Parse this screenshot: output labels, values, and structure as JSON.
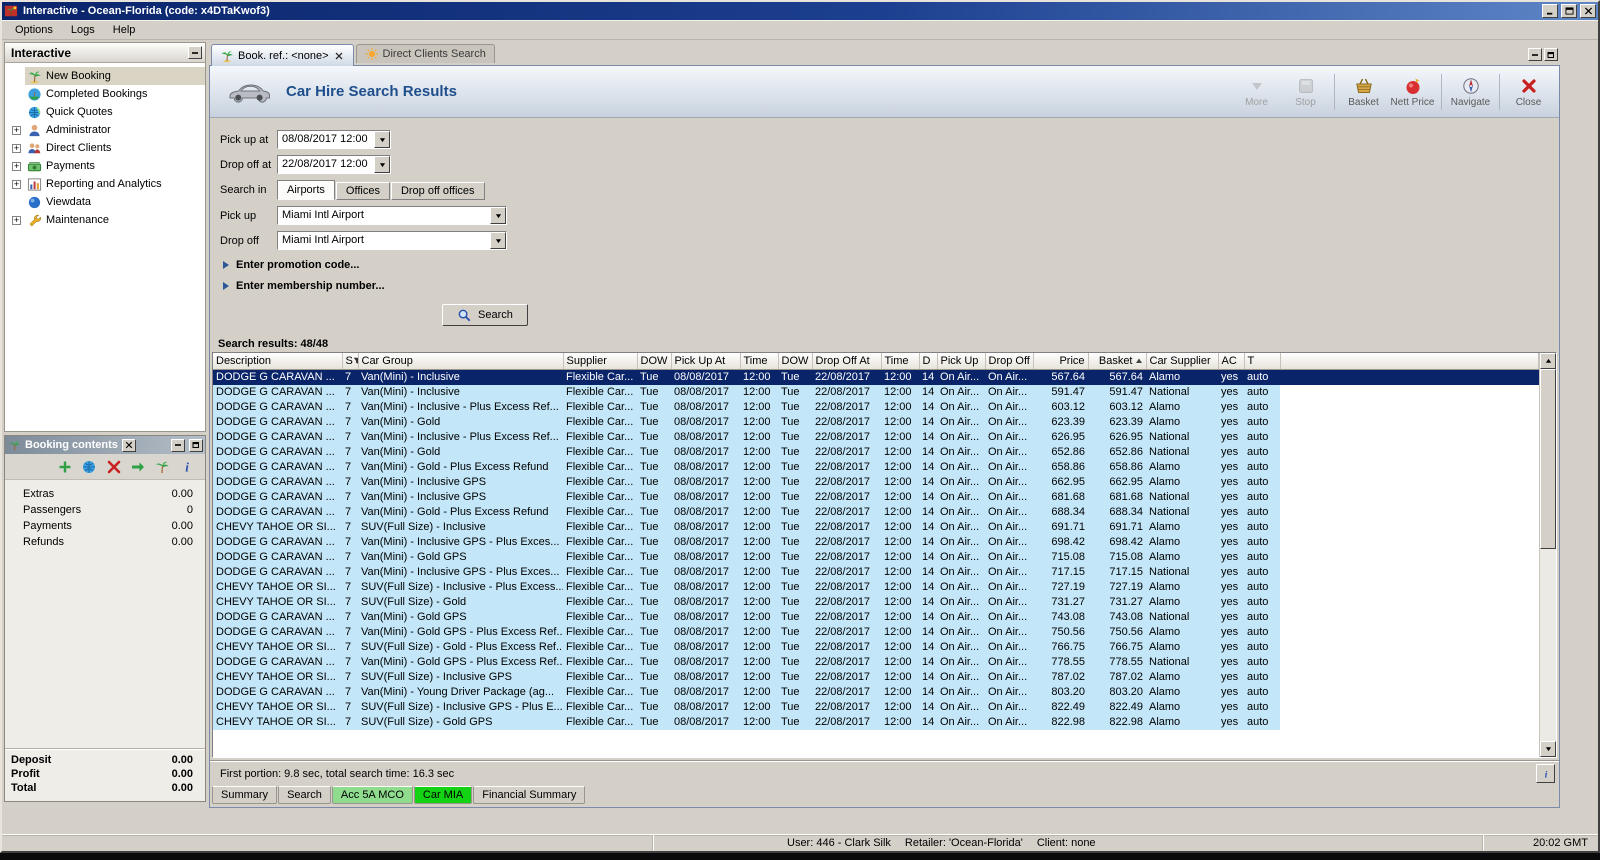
{
  "titlebar": {
    "title": "Interactive - Ocean-Florida (code: x4DTaKwof3)"
  },
  "menubar": {
    "items": [
      "Options",
      "Logs",
      "Help"
    ]
  },
  "sidebar": {
    "title": "Interactive",
    "items": [
      {
        "label": "New Booking",
        "icon": "palm-icon",
        "expandable": false,
        "selected": true
      },
      {
        "label": "Completed Bookings",
        "icon": "completed-bookings-icon",
        "expandable": false,
        "selected": false
      },
      {
        "label": "Quick Quotes",
        "icon": "quick-quotes-icon",
        "expandable": false,
        "selected": false
      },
      {
        "label": "Administrator",
        "icon": "administrator-icon",
        "expandable": true,
        "selected": false
      },
      {
        "label": "Direct Clients",
        "icon": "direct-clients-icon",
        "expandable": true,
        "selected": false
      },
      {
        "label": "Payments",
        "icon": "payments-icon",
        "expandable": true,
        "selected": false
      },
      {
        "label": "Reporting and Analytics",
        "icon": "reporting-icon",
        "expandable": true,
        "selected": false
      },
      {
        "label": "Viewdata",
        "icon": "viewdata-icon",
        "expandable": false,
        "selected": false
      },
      {
        "label": "Maintenance",
        "icon": "maintenance-icon",
        "expandable": true,
        "selected": false
      }
    ]
  },
  "booking_contents": {
    "title": "Booking contents",
    "toolbar": [
      {
        "icon": "add-icon"
      },
      {
        "icon": "globe-icon"
      },
      {
        "icon": "delete-icon"
      },
      {
        "icon": "transfer-icon"
      },
      {
        "icon": "palm-small-icon"
      },
      {
        "icon": "info-icon"
      }
    ],
    "rows": [
      {
        "label": "Extras",
        "value": "0.00"
      },
      {
        "label": "Passengers",
        "value": "0"
      },
      {
        "label": "Payments",
        "value": "0.00"
      },
      {
        "label": "Refunds",
        "value": "0.00"
      }
    ],
    "totals": [
      {
        "label": "Deposit",
        "value": "0.00"
      },
      {
        "label": "Profit",
        "value": "0.00"
      },
      {
        "label": "Total",
        "value": "0.00"
      }
    ]
  },
  "document_tabs": [
    {
      "label": "Book. ref.: <none>",
      "icon": "palm-icon",
      "closable": true,
      "active": true
    },
    {
      "label": "Direct Clients Search",
      "icon": "sun-icon",
      "closable": false,
      "active": false
    }
  ],
  "page": {
    "title": "Car Hire Search Results"
  },
  "action_toolbar": [
    {
      "label": "More",
      "icon": "more-icon",
      "disabled": true
    },
    {
      "label": "Stop",
      "icon": "stop-icon",
      "disabled": true
    },
    {
      "label": "Basket",
      "icon": "basket-icon",
      "disabled": false
    },
    {
      "label": "Nett Price",
      "icon": "nett-price-icon",
      "disabled": false
    },
    {
      "label": "Navigate",
      "icon": "navigate-icon",
      "disabled": false
    },
    {
      "label": "Close",
      "icon": "close-red-icon",
      "disabled": false
    }
  ],
  "search_form": {
    "pick_up_at": {
      "label": "Pick up at",
      "value": "08/08/2017 12:00"
    },
    "drop_off_at": {
      "label": "Drop off at",
      "value": "22/08/2017 12:00"
    },
    "search_in": {
      "label": "Search in",
      "options": [
        "Airports",
        "Offices",
        "Drop off offices"
      ],
      "selected": "Airports"
    },
    "pick_up": {
      "label": "Pick up",
      "value": "Miami Intl Airport"
    },
    "drop_off": {
      "label": "Drop off",
      "value": "Miami Intl Airport"
    },
    "promotion": "Enter promotion code...",
    "membership": "Enter membership number...",
    "search_button": "Search"
  },
  "results": {
    "summary": "Search results: 48/48",
    "status": "First portion: 9.8 sec, total search time: 16.3 sec"
  },
  "results_table": {
    "columns": [
      "Description",
      "S",
      "Car Group",
      "Supplier",
      "DOW",
      "Pick Up At",
      "Time",
      "DOW",
      "Drop Off At",
      "Time",
      "D",
      "Pick Up",
      "Drop Off",
      "Price",
      "Basket",
      "Car Supplier",
      "AC",
      "T"
    ],
    "row_defaults": {
      "seats": "7",
      "supplier": "Flexible Car...",
      "dow": "Tue",
      "pick_up_at": "08/08/2017",
      "time": "12:00",
      "drop_off_at": "22/08/2017",
      "days": "14",
      "pick_up": "On Air...",
      "drop_off": "On Air...",
      "ac": "yes",
      "transmission": "auto"
    },
    "rows": [
      {
        "description": "DODGE G CARAVAN ...",
        "car_group": "Van(Mini) - Inclusive",
        "price": "567.64",
        "basket": "567.64",
        "car_supplier": "Alamo",
        "selected": true
      },
      {
        "description": "DODGE G CARAVAN ...",
        "car_group": "Van(Mini) - Inclusive",
        "price": "591.47",
        "basket": "591.47",
        "car_supplier": "National",
        "selected": false
      },
      {
        "description": "DODGE G CARAVAN ...",
        "car_group": "Van(Mini) - Inclusive - Plus Excess Ref...",
        "price": "603.12",
        "basket": "603.12",
        "car_supplier": "Alamo",
        "selected": false
      },
      {
        "description": "DODGE G CARAVAN ...",
        "car_group": "Van(Mini) - Gold",
        "price": "623.39",
        "basket": "623.39",
        "car_supplier": "Alamo",
        "selected": false
      },
      {
        "description": "DODGE G CARAVAN ...",
        "car_group": "Van(Mini) - Inclusive - Plus Excess Ref...",
        "price": "626.95",
        "basket": "626.95",
        "car_supplier": "National",
        "selected": false
      },
      {
        "description": "DODGE G CARAVAN ...",
        "car_group": "Van(Mini) - Gold",
        "price": "652.86",
        "basket": "652.86",
        "car_supplier": "National",
        "selected": false
      },
      {
        "description": "DODGE G CARAVAN ...",
        "car_group": "Van(Mini) - Gold - Plus Excess Refund",
        "price": "658.86",
        "basket": "658.86",
        "car_supplier": "Alamo",
        "selected": false
      },
      {
        "description": "DODGE G CARAVAN ...",
        "car_group": "Van(Mini) - Inclusive GPS",
        "price": "662.95",
        "basket": "662.95",
        "car_supplier": "Alamo",
        "selected": false
      },
      {
        "description": "DODGE G CARAVAN ...",
        "car_group": "Van(Mini) - Inclusive GPS",
        "price": "681.68",
        "basket": "681.68",
        "car_supplier": "National",
        "selected": false
      },
      {
        "description": "DODGE G CARAVAN ...",
        "car_group": "Van(Mini) - Gold - Plus Excess Refund",
        "price": "688.34",
        "basket": "688.34",
        "car_supplier": "National",
        "selected": false
      },
      {
        "description": "CHEVY TAHOE OR SI...",
        "car_group": "SUV(Full Size) - Inclusive",
        "price": "691.71",
        "basket": "691.71",
        "car_supplier": "Alamo",
        "selected": false
      },
      {
        "description": "DODGE G CARAVAN ...",
        "car_group": "Van(Mini) - Inclusive GPS - Plus Exces...",
        "price": "698.42",
        "basket": "698.42",
        "car_supplier": "Alamo",
        "selected": false
      },
      {
        "description": "DODGE G CARAVAN ...",
        "car_group": "Van(Mini) - Gold GPS",
        "price": "715.08",
        "basket": "715.08",
        "car_supplier": "Alamo",
        "selected": false
      },
      {
        "description": "DODGE G CARAVAN ...",
        "car_group": "Van(Mini) - Inclusive GPS - Plus Exces...",
        "price": "717.15",
        "basket": "717.15",
        "car_supplier": "National",
        "selected": false
      },
      {
        "description": "CHEVY TAHOE OR SI...",
        "car_group": "SUV(Full Size) - Inclusive - Plus Excess...",
        "price": "727.19",
        "basket": "727.19",
        "car_supplier": "Alamo",
        "selected": false
      },
      {
        "description": "CHEVY TAHOE OR SI...",
        "car_group": "SUV(Full Size) - Gold",
        "price": "731.27",
        "basket": "731.27",
        "car_supplier": "Alamo",
        "selected": false
      },
      {
        "description": "DODGE G CARAVAN ...",
        "car_group": "Van(Mini) - Gold GPS",
        "price": "743.08",
        "basket": "743.08",
        "car_supplier": "National",
        "selected": false
      },
      {
        "description": "DODGE G CARAVAN ...",
        "car_group": "Van(Mini) - Gold GPS - Plus Excess Ref...",
        "price": "750.56",
        "basket": "750.56",
        "car_supplier": "Alamo",
        "selected": false
      },
      {
        "description": "CHEVY TAHOE OR SI...",
        "car_group": "SUV(Full Size) - Gold - Plus Excess Ref...",
        "price": "766.75",
        "basket": "766.75",
        "car_supplier": "Alamo",
        "selected": false
      },
      {
        "description": "DODGE G CARAVAN ...",
        "car_group": "Van(Mini) - Gold GPS - Plus Excess Ref...",
        "price": "778.55",
        "basket": "778.55",
        "car_supplier": "National",
        "selected": false
      },
      {
        "description": "CHEVY TAHOE OR SI...",
        "car_group": "SUV(Full Size) - Inclusive GPS",
        "price": "787.02",
        "basket": "787.02",
        "car_supplier": "Alamo",
        "selected": false
      },
      {
        "description": "DODGE G CARAVAN ...",
        "car_group": "Van(Mini) - Young Driver Package (ag...",
        "price": "803.20",
        "basket": "803.20",
        "car_supplier": "Alamo",
        "selected": false
      },
      {
        "description": "CHEVY TAHOE OR SI...",
        "car_group": "SUV(Full Size) - Inclusive GPS - Plus E...",
        "price": "822.49",
        "basket": "822.49",
        "car_supplier": "Alamo",
        "selected": false
      },
      {
        "description": "CHEVY TAHOE OR SI...",
        "car_group": "SUV(Full Size) - Gold GPS",
        "price": "822.98",
        "basket": "822.98",
        "car_supplier": "Alamo",
        "selected": false
      }
    ]
  },
  "bottom_tabs": [
    {
      "label": "Summary",
      "highlight": "",
      "active": false
    },
    {
      "label": "Search",
      "highlight": "",
      "active": false
    },
    {
      "label": "Acc 5A MCO",
      "highlight": "#8fdc8f",
      "active": false
    },
    {
      "label": "Car MIA",
      "highlight": "#14d314",
      "active": true
    },
    {
      "label": "Financial Summary",
      "highlight": "",
      "active": false
    }
  ],
  "statusbar": {
    "user": "User: 446 - Clark Silk",
    "retailer": "Retailer: 'Ocean-Florida'",
    "client": "Client: none",
    "clock": "20:02 GMT"
  },
  "colors": {
    "selected_row": "#0a246a",
    "row_blue": "#c3e7f9",
    "title_blue": "#1f4e8c"
  }
}
